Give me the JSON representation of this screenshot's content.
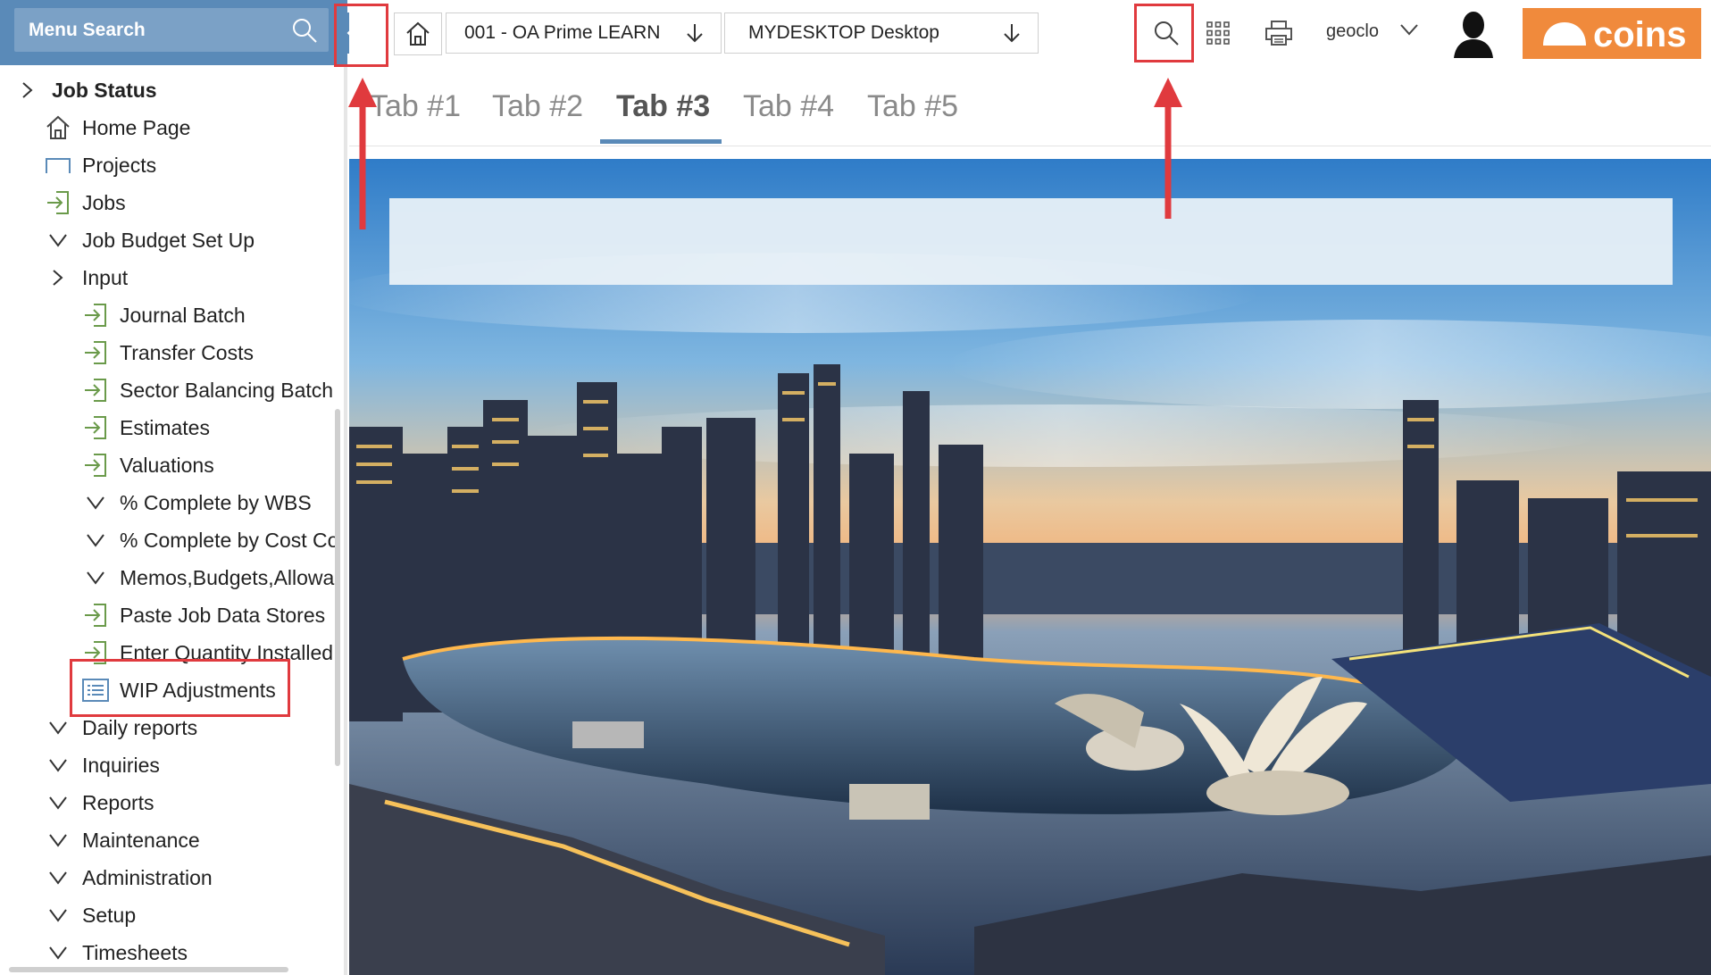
{
  "sidebar": {
    "search_label": "Menu Search",
    "items": [
      {
        "label": "Job Status",
        "icon": "chevron-right-icon",
        "bold": true
      },
      {
        "label": "Home Page",
        "icon": "home-icon"
      },
      {
        "label": "Projects",
        "icon": "folder-icon"
      },
      {
        "label": "Jobs",
        "icon": "enter-icon"
      },
      {
        "label": "Job Budget Set Up",
        "icon": "chevron-down-icon"
      },
      {
        "label": "Input",
        "icon": "chevron-right-icon"
      },
      {
        "label": "Journal Batch",
        "icon": "enter-icon"
      },
      {
        "label": "Transfer Costs",
        "icon": "enter-icon"
      },
      {
        "label": "Sector Balancing Batch",
        "icon": "enter-icon"
      },
      {
        "label": "Estimates",
        "icon": "enter-icon"
      },
      {
        "label": "Valuations",
        "icon": "enter-icon"
      },
      {
        "label": "% Complete by WBS",
        "icon": "chevron-down-icon"
      },
      {
        "label": "% Complete by Cost Co",
        "icon": "chevron-down-icon"
      },
      {
        "label": "Memos,Budgets,Allowa",
        "icon": "chevron-down-icon"
      },
      {
        "label": "Paste Job Data Stores",
        "icon": "enter-icon"
      },
      {
        "label": "Enter Quantity Installed",
        "icon": "enter-icon"
      },
      {
        "label": "WIP Adjustments",
        "icon": "list-icon"
      },
      {
        "label": "Daily reports",
        "icon": "chevron-down-icon"
      },
      {
        "label": "Inquiries",
        "icon": "chevron-down-icon"
      },
      {
        "label": "Reports",
        "icon": "chevron-down-icon"
      },
      {
        "label": "Maintenance",
        "icon": "chevron-down-icon"
      },
      {
        "label": "Administration",
        "icon": "chevron-down-icon"
      },
      {
        "label": "Setup",
        "icon": "chevron-down-icon"
      },
      {
        "label": "Timesheets",
        "icon": "chevron-down-icon"
      }
    ]
  },
  "topbar": {
    "breadcrumbs": [
      {
        "label": "001 - OA Prime LEARN"
      },
      {
        "label": "MYDESKTOP Desktop"
      }
    ],
    "user": "geoclo",
    "logo_text": "coins"
  },
  "tabs": [
    {
      "label": "Tab #1",
      "active": false
    },
    {
      "label": "Tab #2",
      "active": false
    },
    {
      "label": "Tab #3",
      "active": true
    },
    {
      "label": "Tab #4",
      "active": false
    },
    {
      "label": "Tab #5",
      "active": false
    }
  ],
  "colors": {
    "sidebar_header": "#5a8ab8",
    "accent": "#5a8ab8",
    "logo_bg": "#f08a3c",
    "callout": "#e03a3e"
  }
}
